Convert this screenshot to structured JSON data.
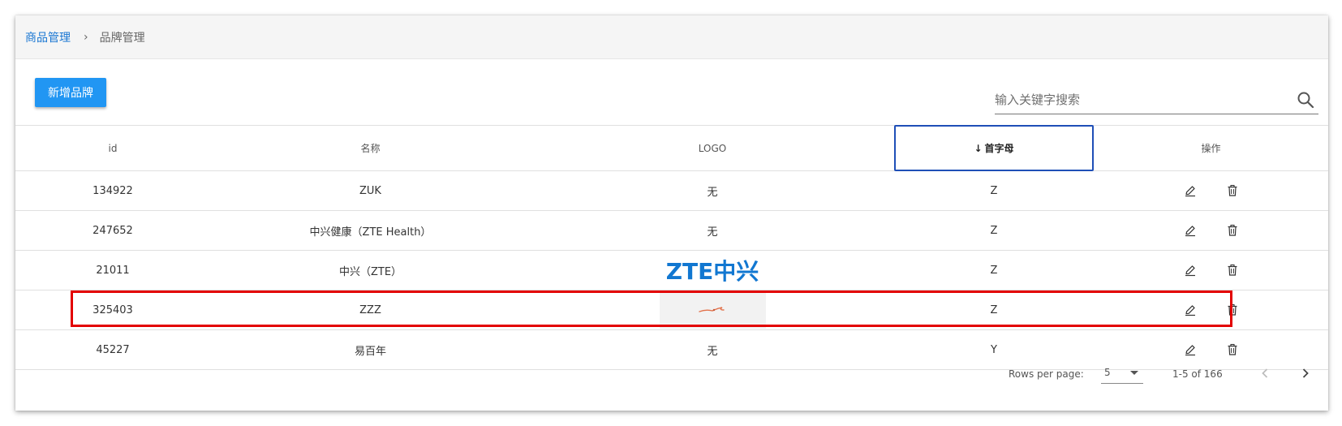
{
  "breadcrumb": {
    "parent": "商品管理",
    "separator": "›",
    "current": "品牌管理"
  },
  "toolbar": {
    "add_label": "新增品牌",
    "search_placeholder": "输入关键字搜索"
  },
  "table": {
    "headers": {
      "id": "id",
      "name": "名称",
      "logo": "LOGO",
      "letter": "首字母",
      "ops": "操作"
    },
    "sort_indicator": "↓",
    "rows": [
      {
        "id": "134922",
        "name": "ZUK",
        "logo": "无",
        "letter": "Z"
      },
      {
        "id": "247652",
        "name": "中兴健康（ZTE Health）",
        "logo": "无",
        "letter": "Z"
      },
      {
        "id": "21011",
        "name": "中兴（ZTE）",
        "logo": "ZTE中兴",
        "letter": "Z"
      },
      {
        "id": "325403",
        "name": "ZZZ",
        "logo": "",
        "letter": "Z"
      },
      {
        "id": "45227",
        "name": "易百年",
        "logo": "无",
        "letter": "Y"
      }
    ]
  },
  "footer": {
    "rows_per_page_label": "Rows per page:",
    "rows_per_page_value": "5",
    "range": "1-5 of 166"
  },
  "colors": {
    "primary": "#2196f3",
    "link": "#1976d2",
    "highlight": "#e30000",
    "zte_logo": "#1177d1"
  }
}
